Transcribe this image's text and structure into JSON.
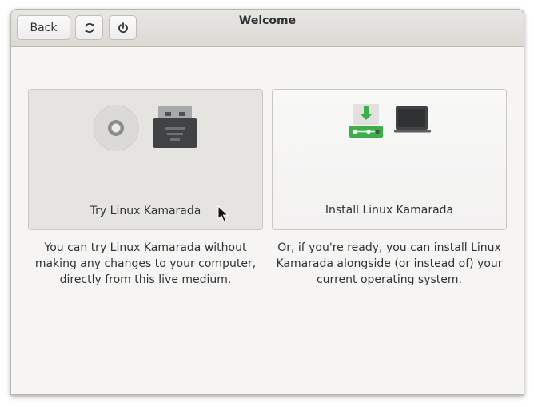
{
  "window": {
    "title": "Welcome"
  },
  "header": {
    "back_label": "Back",
    "refresh_icon": "refresh-icon",
    "power_icon": "power-icon"
  },
  "options": {
    "try": {
      "label": "Try Linux Kamarada",
      "description": "You can try Linux Kamarada without making any changes to your computer, directly from this live medium.",
      "icons": [
        "disc-icon",
        "usb-drive-icon"
      ]
    },
    "install": {
      "label": "Install Linux Kamarada",
      "description": "Or, if you're ready, you can install Linux Kamarada alongside (or instead of) your current operating system.",
      "icons": [
        "download-disk-icon",
        "laptop-icon"
      ]
    }
  },
  "colors": {
    "accent_green": "#3cae4a",
    "window_bg": "#f6f5f4",
    "text": "#2e3436"
  }
}
